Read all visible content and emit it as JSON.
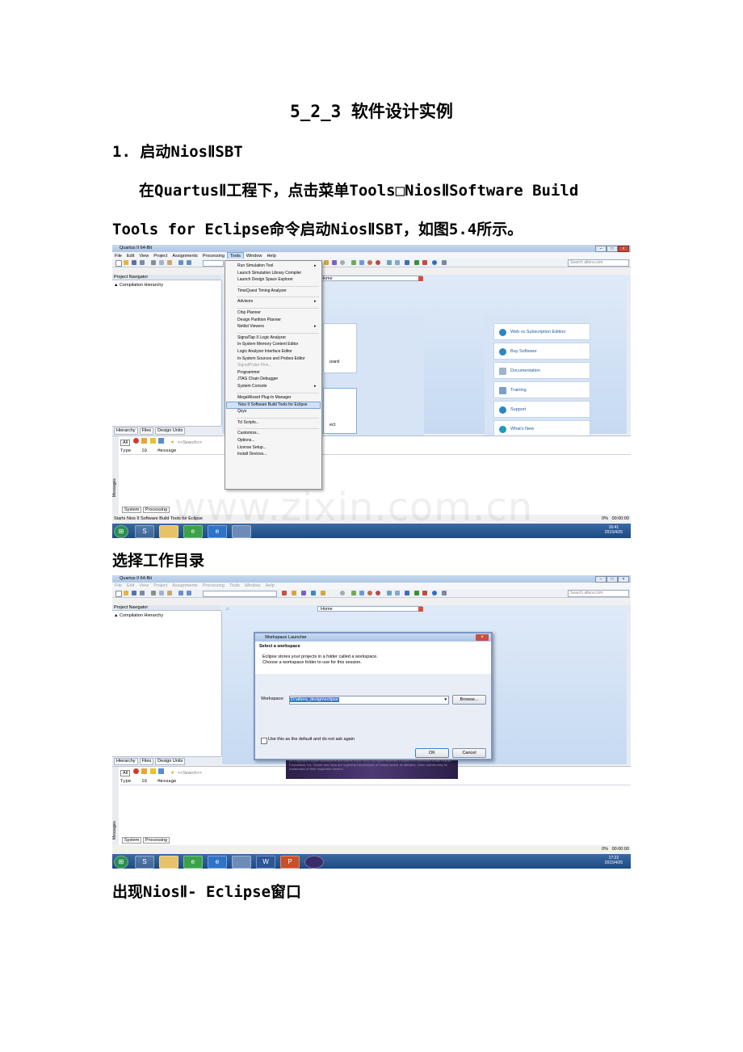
{
  "doc": {
    "heading": "5_2_3 软件设计实例",
    "step1": "1. 启动NiosⅡSBT",
    "para_line1": "在QuartusⅡ工程下，点击菜单Tools□NiosⅡSoftware Build",
    "para_line2": "Tools for Eclipse命令启动NiosⅡSBT，如图5.4所示。",
    "caption2": "选择工作目录",
    "caption3": "出现NiosⅡ- Eclipse窗口"
  },
  "quartus": {
    "title": "Quartus II 64-Bit",
    "menus": [
      "File",
      "Edit",
      "View",
      "Project",
      "Assignments",
      "Processing",
      "Tools",
      "Window",
      "Help"
    ],
    "search_placeholder": "Search altera.com",
    "project_navigator": "Project Navigator",
    "compilation_hierarchy": "Compilation Hierarchy",
    "nav_tabs": [
      "Hierarchy",
      "Files",
      "Design Units"
    ],
    "home_tab": "Home",
    "search_messages": "<<Search>>",
    "filter_all": "All",
    "msg_columns": [
      "Type",
      "ID",
      "Message"
    ],
    "msg_tabs": [
      "System",
      "Processing"
    ],
    "messages_label": "Messages",
    "progress": "0%",
    "elapsed": "00:00:00",
    "status_text": "Starts Nios II Software Build Tools for Eclipse",
    "wizard_fragment": "izard",
    "project_fragment": "ect",
    "tiles": [
      "Web vs Subscription Edition",
      "Buy Software",
      "Documentation",
      "Training",
      "Support",
      "What's New"
    ]
  },
  "tools_menu": {
    "items": [
      {
        "label": "Run Simulation Tool",
        "submenu": true
      },
      {
        "label": "Launch Simulation Library Compiler"
      },
      {
        "label": "Launch Design Space Explorer"
      },
      {
        "sep": true
      },
      {
        "label": "TimeQuest Timing Analyzer"
      },
      {
        "sep": true
      },
      {
        "label": "Advisors",
        "submenu": true
      },
      {
        "sep": true
      },
      {
        "label": "Chip Planner"
      },
      {
        "label": "Design Partition Planner"
      },
      {
        "label": "Netlist Viewers",
        "submenu": true
      },
      {
        "sep": true
      },
      {
        "label": "SignalTap II Logic Analyzer"
      },
      {
        "label": "In-System Memory Content Editor"
      },
      {
        "label": "Logic Analyzer Interface Editor"
      },
      {
        "label": "In-System Sources and Probes Editor"
      },
      {
        "label": "SignalProbe Pins...",
        "disabled": true
      },
      {
        "label": "Programmer"
      },
      {
        "label": "JTAG Chain Debugger"
      },
      {
        "label": "System Console",
        "submenu": true
      },
      {
        "sep": true
      },
      {
        "label": "MegaWizard Plug-In Manager"
      },
      {
        "label": "Nios II Software Build Tools for Eclipse",
        "selected": true
      },
      {
        "label": "Qsys"
      },
      {
        "sep": true
      },
      {
        "label": "Tcl Scripts..."
      },
      {
        "sep": true
      },
      {
        "label": "Customize..."
      },
      {
        "label": "Options..."
      },
      {
        "label": "License Setup..."
      },
      {
        "label": "Install Devices..."
      }
    ]
  },
  "taskbar1": {
    "time": "16:41",
    "date": "2015/4/25"
  },
  "taskbar2": {
    "time": "17:22",
    "date": "2015/4/25"
  },
  "workspace_dialog": {
    "title": "Workspace Launcher",
    "heading": "Select a workspace",
    "desc1": "Eclipse stores your projects in a folder called a workspace.",
    "desc2": "Choose a workspace folder to use for this session.",
    "workspace_label": "Workspace:",
    "workspace_value": "D:\\altera_design\\eclipse",
    "browse": "Browse...",
    "checkbox_label": "Use this as the default and do not ask again",
    "ok": "OK",
    "cancel": "Cancel"
  },
  "splash_text": "(c) Copyright Eclipse contributors and others 2000, 2012. All rights reserved. Eclipse is a trademark of the Eclipse Foundation, Inc. Oracle and Java are registered trademarks of Oracle and/or its affiliates. Other names may be trademarks of their respective owners.",
  "watermark": "www.zixin.com.cn"
}
